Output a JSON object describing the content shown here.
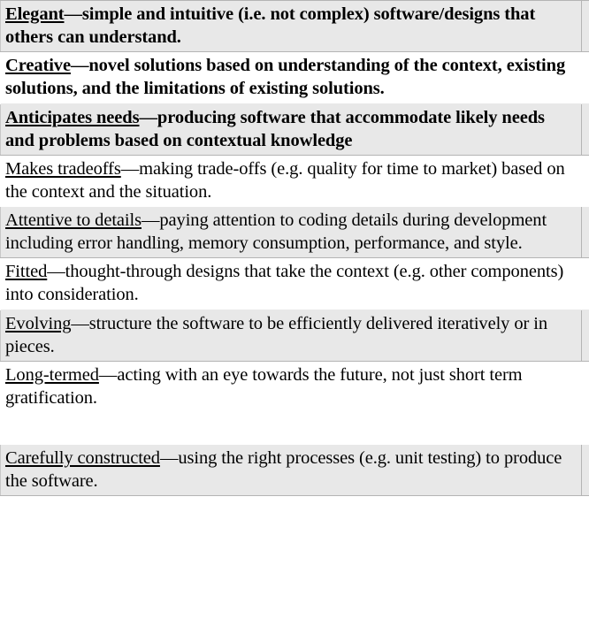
{
  "document": {
    "type": "attribute-table",
    "colors": {
      "shaded_row_background": "#e8e8e8",
      "plain_row_background": "#ffffff",
      "border": "#b4b4b4",
      "text": "#000000"
    },
    "columns": [
      "attribute-description",
      "spacer"
    ],
    "rows": [
      {
        "term": "Elegant",
        "separator": "—",
        "description": "simple and intuitive (i.e. not complex) software/designs that others can understand.",
        "bold": true,
        "shaded": true
      },
      {
        "term": "Creative",
        "separator": "—",
        "description": "novel solutions based on understanding of the context, existing solutions, and the limitations of existing solutions.",
        "bold": true,
        "shaded": false
      },
      {
        "term": "Anticipates needs",
        "separator": "—",
        "description": "producing software that accommodate likely needs and problems based on contextual knowledge",
        "bold": true,
        "shaded": true
      },
      {
        "term": "Makes tradeoffs",
        "separator": "—",
        "description": "making trade-offs (e.g. quality for time to market) based on the context and the situation.",
        "bold": false,
        "shaded": false
      },
      {
        "term": "Attentive to details",
        "separator": "—",
        "description": "paying attention to coding details during development including error handling, memory consumption, performance, and style.",
        "bold": false,
        "shaded": true
      },
      {
        "term": "Fitted",
        "separator": "—",
        "description": "thought-through designs that take the context (e.g. other components) into consideration.",
        "bold": false,
        "shaded": false
      },
      {
        "term": "Evolving",
        "separator": "—",
        "description": "structure the software to be efficiently delivered iteratively or in pieces.",
        "bold": false,
        "shaded": true
      },
      {
        "term": "Long-termed",
        "separator": "—",
        "description": "acting with an eye towards the future, not just short term gratification.",
        "bold": false,
        "shaded": false
      },
      {
        "term": "",
        "separator": "",
        "description": "",
        "bold": false,
        "shaded": false,
        "blank": true
      },
      {
        "term": "Carefully constructed",
        "separator": "—",
        "description": "using the right processes (e.g. unit testing) to produce the software.",
        "bold": false,
        "shaded": true
      }
    ]
  }
}
